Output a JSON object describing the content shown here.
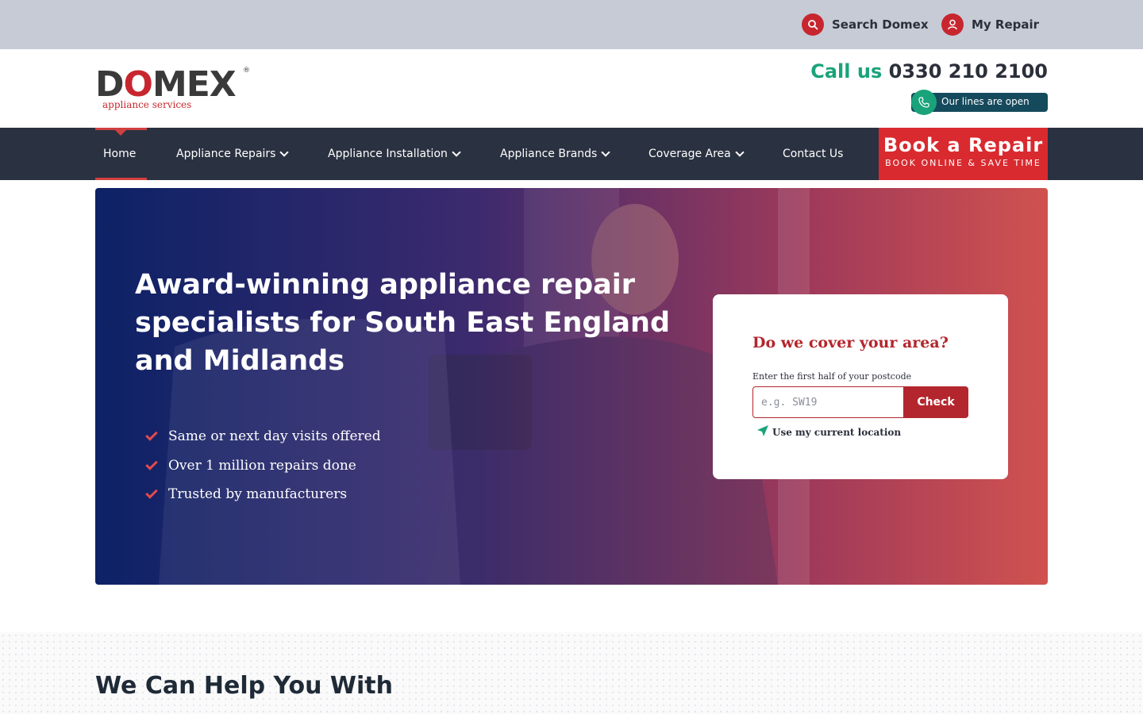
{
  "utility": {
    "search_label": "Search Domex",
    "repair_label": "My Repair"
  },
  "logo": {
    "word_d": "D",
    "word_o": "O",
    "word_rest": "MEX",
    "registered": "®",
    "tagline": "appliance services"
  },
  "contact": {
    "call_lead": "Call us",
    "phone": "0330 210 2100",
    "lines_status": "Our lines are open"
  },
  "nav": {
    "items": [
      {
        "label": "Home"
      },
      {
        "label": "Appliance Repairs"
      },
      {
        "label": "Appliance Installation"
      },
      {
        "label": "Appliance Brands"
      },
      {
        "label": "Coverage Area"
      },
      {
        "label": "Contact Us"
      }
    ],
    "book_title": "Book a Repair",
    "book_sub": "BOOK ONLINE & SAVE TIME"
  },
  "hero": {
    "heading": "Award-winning appliance repair specialists for South East England and Midlands",
    "bullets": [
      "Same or next day visits offered",
      "Over 1 million repairs done",
      "Trusted by manufacturers"
    ]
  },
  "coverage": {
    "title": "Do we cover your area?",
    "postcode_label": "Enter the first half of your postcode",
    "postcode_placeholder": "e.g. SW19",
    "postcode_value": "",
    "check_label": "Check",
    "location_label": "Use my current location"
  },
  "help": {
    "heading": "We Can Help You With"
  },
  "colors": {
    "brand_red": "#c8262f",
    "accent_green": "#1aa37a",
    "nav_bg": "#2a3140",
    "hero_start": "#0d2266",
    "hero_end": "#d0524f"
  },
  "icons": {
    "search": "search-icon",
    "user": "user-icon",
    "phone": "phone-icon",
    "chevron": "chevron-down-icon",
    "check": "check-icon",
    "location": "location-arrow-icon"
  }
}
